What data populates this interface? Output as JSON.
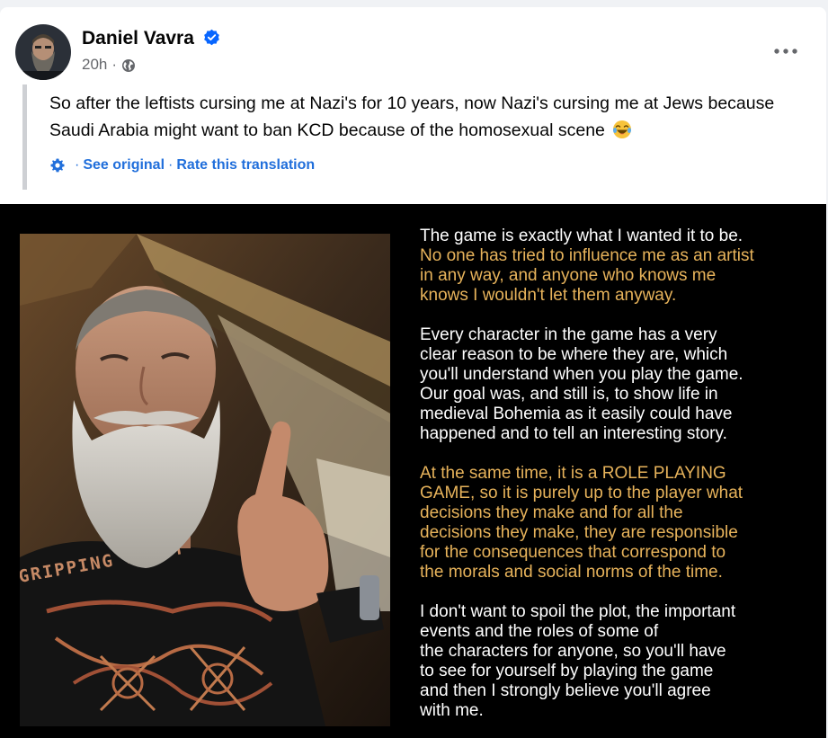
{
  "post": {
    "author": "Daniel Vavra",
    "timestamp": "20h",
    "separator": "·",
    "text": "So after the leftists cursing me at Nazi's for 10 years, now Nazi's cursing me at Jews because Saudi Arabia might want to ban KCD because of the homosexual scene",
    "emoji": "😂",
    "see_original": "See original",
    "rate_translation": "Rate this translation"
  },
  "icons": {
    "more": "more-options-icon",
    "verified": "verified-badge-icon",
    "audience": "globe-icon",
    "translation": "gear-icon"
  },
  "image_text": {
    "paragraphs": [
      {
        "lines": [
          {
            "text": "The game is exactly what I wanted it to be.",
            "color": "white"
          },
          {
            "text": "No one has tried to influence me as an artist",
            "color": "gold"
          },
          {
            "text": "in any way, and anyone who knows me",
            "color": "gold"
          },
          {
            "text": "knows I wouldn't let them anyway.",
            "color": "gold"
          }
        ]
      },
      {
        "lines": [
          {
            "text": "Every character in the game has a very",
            "color": "white"
          },
          {
            "text": "clear reason to be where they are, which",
            "color": "white"
          },
          {
            "text": "you'll understand when you play the game.",
            "color": "white"
          },
          {
            "text": "Our goal was, and still is, to show life in",
            "color": "white"
          },
          {
            "text": "medieval Bohemia as it easily could have",
            "color": "white"
          },
          {
            "text": "happened and to tell an interesting story.",
            "color": "white"
          }
        ]
      },
      {
        "lines": [
          {
            "text": "At the same time, it is a ROLE PLAYING",
            "color": "gold"
          },
          {
            "text": "GAME, so it is purely up to the player what",
            "color": "gold"
          },
          {
            "text": "decisions they make and for all the",
            "color": "gold"
          },
          {
            "text": "decisions they make, they are responsible",
            "color": "gold"
          },
          {
            "text": "for the consequences that correspond to",
            "color": "gold"
          },
          {
            "text": "the morals and social norms of the time.",
            "color": "gold"
          }
        ]
      },
      {
        "lines": [
          {
            "text": "I don't want to spoil the plot, the important",
            "color": "white"
          },
          {
            "text": "events and the roles of some of",
            "color": "white"
          },
          {
            "text": "the characters for anyone, so you'll have",
            "color": "white"
          },
          {
            "text": "to see for yourself by playing the game",
            "color": "white"
          },
          {
            "text": "and then I strongly believe you'll agree",
            "color": "white"
          },
          {
            "text": "with me.",
            "color": "white"
          }
        ]
      }
    ],
    "shirt_print": "GRIPPING BEAST"
  },
  "colors": {
    "white_text": "#ffffff",
    "gold_text": "#e7b35b",
    "link_blue": "#216fdb",
    "verified_blue": "#0866ff"
  }
}
